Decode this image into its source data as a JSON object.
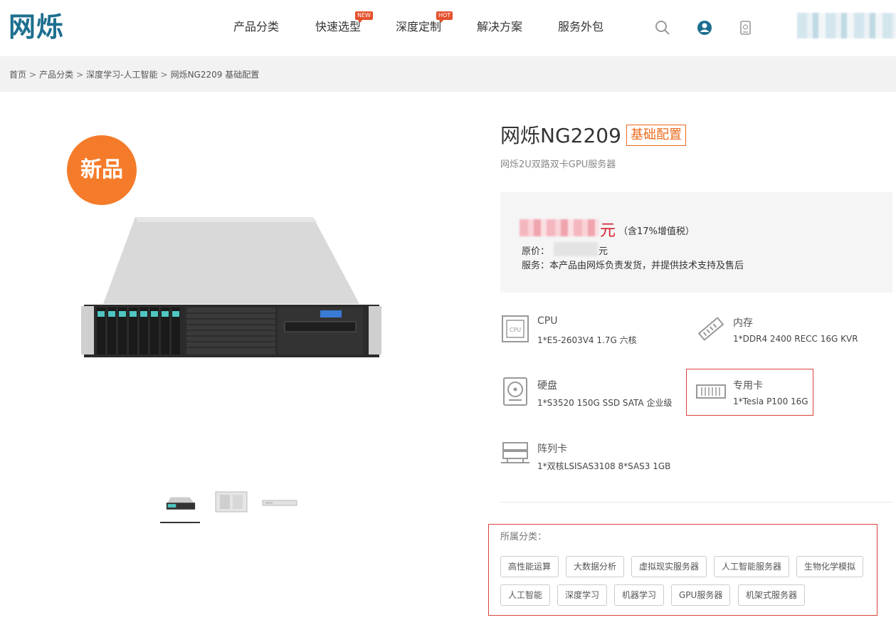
{
  "header": {
    "logo": "网烁",
    "nav": [
      {
        "label": "产品分类",
        "badge": ""
      },
      {
        "label": "快速选型",
        "badge": "NEW"
      },
      {
        "label": "深度定制",
        "badge": "HOT"
      },
      {
        "label": "解决方案",
        "badge": ""
      },
      {
        "label": "服务外包",
        "badge": ""
      }
    ],
    "icons": [
      "search-icon",
      "user-icon",
      "phone-icon"
    ]
  },
  "breadcrumb": {
    "items": [
      "首页",
      "产品分类",
      "深度学习-人工智能",
      "网烁NG2209 基础配置"
    ],
    "separator": ">"
  },
  "gallery": {
    "badge": "新品",
    "thumbnail_count": 3
  },
  "product": {
    "title": "网烁NG2209",
    "config_tag": "基础配置",
    "subtitle": "网烁2U双路双卡GPU服务器",
    "price_unit": "元",
    "price_tax": "（含17%增值税）",
    "original_label": "原价：",
    "original_unit": "元",
    "service": "服务：本产品由网烁负责发货，并提供技术支持及售后"
  },
  "specs": [
    {
      "label": "CPU",
      "value": "1*E5-2603V4 1.7G 六核",
      "icon": "cpu-icon"
    },
    {
      "label": "内存",
      "value": "1*DDR4 2400 RECC 16G KVR",
      "icon": "memory-icon"
    },
    {
      "label": "硬盘",
      "value": "1*S3520 150G SSD SATA 企业级",
      "icon": "hard-disk-icon"
    },
    {
      "label": "专用卡",
      "value": "1*Tesla P100 16G",
      "icon": "gpu-card-icon"
    },
    {
      "label": "阵列卡",
      "value": "1*双核LSISAS3108 8*SAS3 1GB",
      "icon": "raid-card-icon"
    }
  ],
  "categories": {
    "title": "所属分类：",
    "tags": [
      "高性能运算",
      "大数据分析",
      "虚拟现实服务器",
      "人工智能服务器",
      "生物化学模拟",
      "人工智能",
      "深度学习",
      "机器学习",
      "GPU服务器",
      "机架式服务器"
    ]
  },
  "colors": {
    "brand": "#1d6f8f",
    "accent_orange": "#f47b2a",
    "tag_orange": "#e96b1e",
    "price_red": "#d6202c",
    "highlight_border": "#d9443c"
  }
}
